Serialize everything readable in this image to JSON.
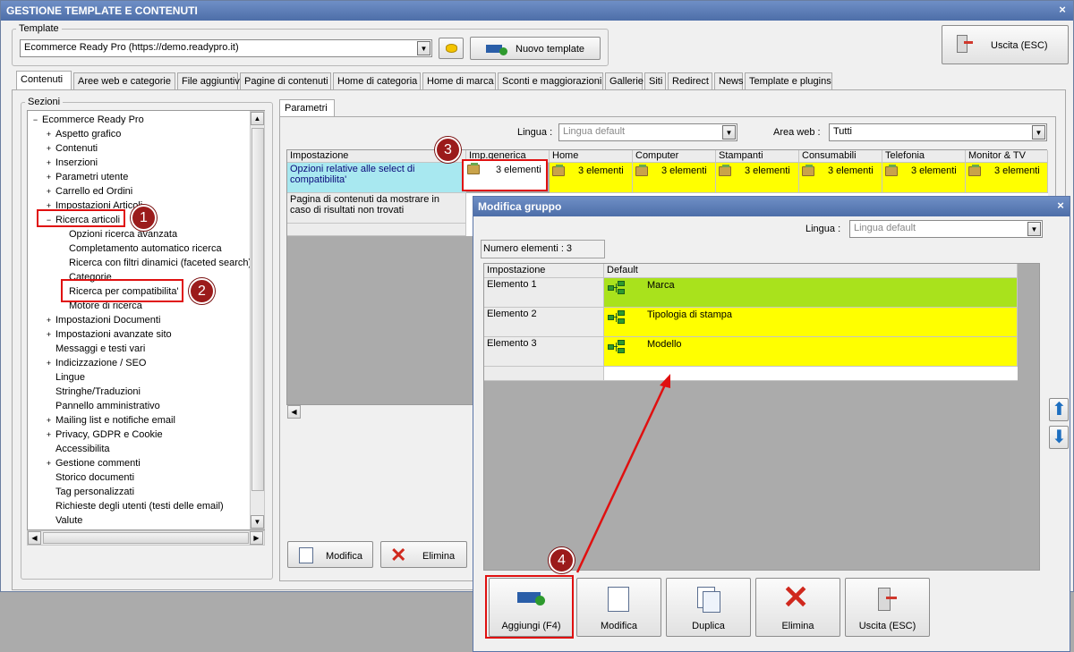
{
  "main": {
    "title": "GESTIONE TEMPLATE E CONTENUTI",
    "close": "×",
    "template_group_label": "Template",
    "template_value": "Ecommerce Ready Pro (https://demo.readypro.it)",
    "new_template_label": "Nuovo template",
    "exit_label": "Uscita (ESC)",
    "tabs": [
      "Contenuti",
      "Aree web e categorie",
      "File aggiuntivi",
      "Pagine di contenuti",
      "Home di categoria",
      "Home di marca",
      "Sconti e maggiorazioni",
      "Gallerie",
      "Siti",
      "Redirect",
      "News",
      "Template e plugins"
    ],
    "sections_label": "Sezioni",
    "tree": [
      {
        "label": "Ecommerce Ready Pro",
        "sign": "−"
      },
      {
        "label": "Aspetto grafico",
        "sign": "+"
      },
      {
        "label": "Contenuti",
        "sign": "+"
      },
      {
        "label": "Inserzioni",
        "sign": "+"
      },
      {
        "label": "Parametri utente",
        "sign": "+"
      },
      {
        "label": "Carrello ed Ordini",
        "sign": "+"
      },
      {
        "label": "Impostazioni Articoli",
        "sign": "+"
      },
      {
        "label": "Ricerca articoli",
        "sign": "−"
      },
      {
        "label": "Opzioni ricerca avanzata",
        "sign": ""
      },
      {
        "label": "Completamento automatico ricerca",
        "sign": ""
      },
      {
        "label": "Ricerca con filtri dinamici (faceted search)",
        "sign": ""
      },
      {
        "label": "Categorie",
        "sign": ""
      },
      {
        "label": "Ricerca per compatibilita'",
        "sign": ""
      },
      {
        "label": "Motore di ricerca",
        "sign": ""
      },
      {
        "label": "Impostazioni Documenti",
        "sign": "+"
      },
      {
        "label": "Impostazioni avanzate sito",
        "sign": "+"
      },
      {
        "label": "Messaggi e testi vari",
        "sign": ""
      },
      {
        "label": "Indicizzazione / SEO",
        "sign": "+"
      },
      {
        "label": "Lingue",
        "sign": ""
      },
      {
        "label": "Stringhe/Traduzioni",
        "sign": ""
      },
      {
        "label": "Pannello amministrativo",
        "sign": ""
      },
      {
        "label": "Mailing list e notifiche email",
        "sign": "+"
      },
      {
        "label": "Privacy, GDPR e Cookie",
        "sign": "+"
      },
      {
        "label": "Accessibilita",
        "sign": ""
      },
      {
        "label": "Gestione commenti",
        "sign": "+"
      },
      {
        "label": "Storico documenti",
        "sign": ""
      },
      {
        "label": "Tag personalizzati",
        "sign": ""
      },
      {
        "label": "Richieste degli utenti (testi delle email)",
        "sign": ""
      },
      {
        "label": "Valute",
        "sign": ""
      }
    ],
    "params_tab": "Parametri",
    "lingua_label": "Lingua :",
    "lingua_value": "Lingua default",
    "area_label": "Area web :",
    "area_value": "Tutti",
    "grid_headers": [
      "Impostazione",
      "Imp.generica",
      "Home",
      "Computer",
      "Stampanti",
      "Consumabili",
      "Telefonia",
      "Monitor & TV"
    ],
    "row1_label": "Opzioni relative alle select di compatibilita'",
    "row1_value": "3 elementi",
    "row2_label": "Pagina di contenuti da mostrare in caso di risultati non trovati",
    "modifica_label": "Modifica",
    "elimina_label": "Elimina"
  },
  "dialog": {
    "title": "Modifica gruppo",
    "close": "×",
    "lingua_label": "Lingua :",
    "lingua_value": "Lingua default",
    "count_label": "Numero elementi : 3",
    "headers": [
      "Impostazione",
      "Default"
    ],
    "rows": [
      {
        "name": "Elemento 1",
        "value": "Marca"
      },
      {
        "name": "Elemento 2",
        "value": "Tipologia di stampa"
      },
      {
        "name": "Elemento 3",
        "value": "Modello"
      }
    ],
    "buttons": {
      "add": "Aggiungi (F4)",
      "edit": "Modifica",
      "dup": "Duplica",
      "del": "Elimina",
      "exit": "Uscita (ESC)"
    }
  },
  "callouts": [
    "1",
    "2",
    "3",
    "4"
  ],
  "colors": {
    "highlight": "#ffff00",
    "selected": "#a9e21c",
    "red": "#e01010",
    "titlebar": "#4d6ea8"
  }
}
